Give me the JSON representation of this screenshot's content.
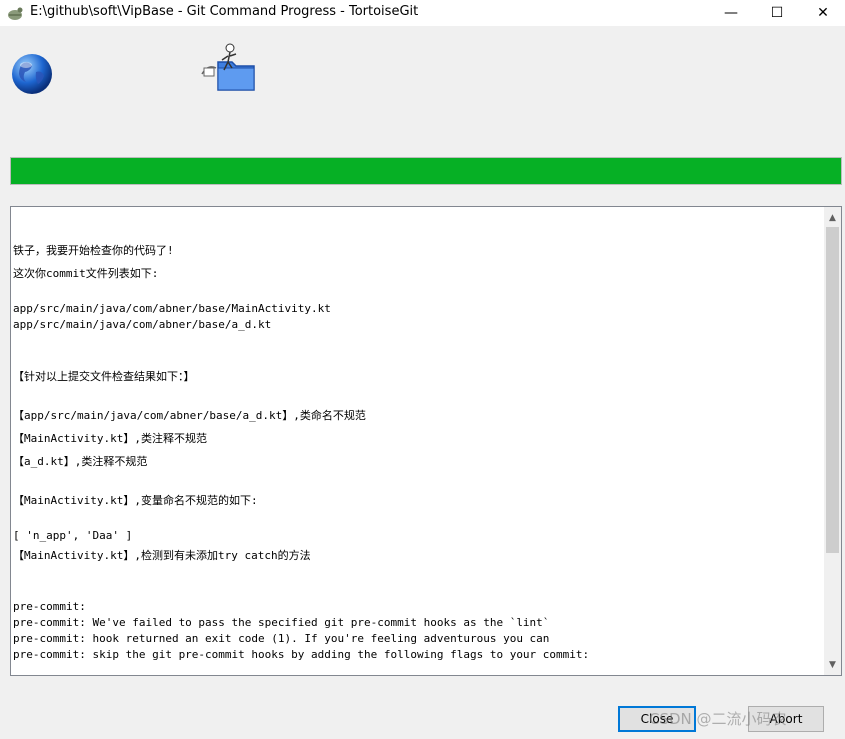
{
  "window": {
    "title": "E:\\github\\soft\\VipBase - Git Command Progress - TortoiseGit",
    "minimize_glyph": "—",
    "maximize_glyph": "☐",
    "close_glyph": "✕"
  },
  "icons": {
    "title": "tortoisegit-app-icon",
    "globe": "globe-icon",
    "folder": "folder-transfer-icon"
  },
  "progress": {
    "percent": 100,
    "color": "#06b025"
  },
  "output": {
    "lines": [
      "铁子，我要开始检查你的代码了!",
      "这次你commit文件列表如下:",
      "",
      "app/src/main/java/com/abner/base/MainActivity.kt",
      "app/src/main/java/com/abner/base/a_d.kt",
      "",
      "",
      "【针对以上提交文件检查结果如下：】",
      "",
      "【app/src/main/java/com/abner/base/a_d.kt】,类命名不规范",
      "【MainActivity.kt】,类注释不规范",
      "【a_d.kt】,类注释不规范",
      "",
      "【MainActivity.kt】,变量命名不规范的如下:",
      "",
      "[ 'n_app', 'Daa' ]",
      "【MainActivity.kt】,检测到有未添加try catch的方法",
      "",
      "",
      "pre-commit:",
      "pre-commit: We've failed to pass the specified git pre-commit hooks as the `lint`",
      "pre-commit: hook returned an exit code (1). If you're feeling adventurous you can",
      "pre-commit: skip the git pre-commit hooks by adding the following flags to your commit:"
    ]
  },
  "buttons": {
    "close": "Close",
    "abort": "Abort"
  },
  "watermark": "CSDN @二流小码农",
  "colors": {
    "accent": "#0078d7",
    "progress": "#06b025"
  }
}
